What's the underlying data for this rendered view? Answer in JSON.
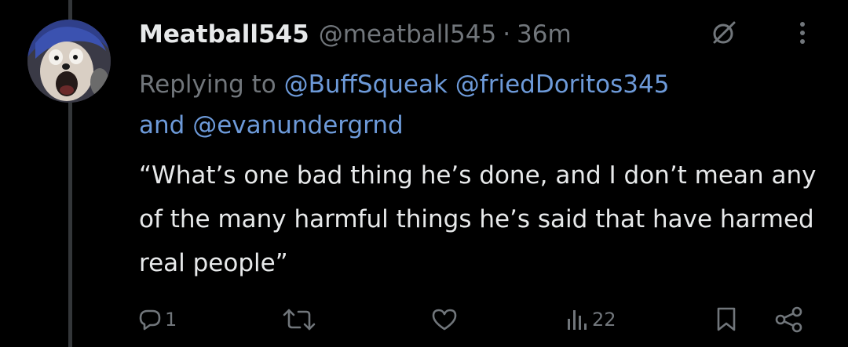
{
  "author": {
    "name": "Meatball545",
    "handle": "@meatball545",
    "separator": "·",
    "time": "36m"
  },
  "reply": {
    "prefix": "Replying to",
    "mentions": [
      "@BuffSqueak",
      "@friedDoritos345",
      "@evanundergrnd"
    ],
    "conjunction": "and"
  },
  "tweet": {
    "text": "“What’s one bad thing he’s done, and I don’t mean any of the many harmful things he’s said that have harmed real people”"
  },
  "actions": {
    "reply_count": "1",
    "views_count": "22"
  },
  "colors": {
    "background": "#000000",
    "primary_text": "#e7e9ea",
    "secondary_text": "#71767b",
    "link": "#6d9ad9"
  },
  "icons": {
    "header": [
      "grok-icon",
      "more-icon"
    ],
    "actions": [
      "reply-icon",
      "repost-icon",
      "like-icon",
      "views-icon",
      "bookmark-icon",
      "share-icon"
    ]
  }
}
